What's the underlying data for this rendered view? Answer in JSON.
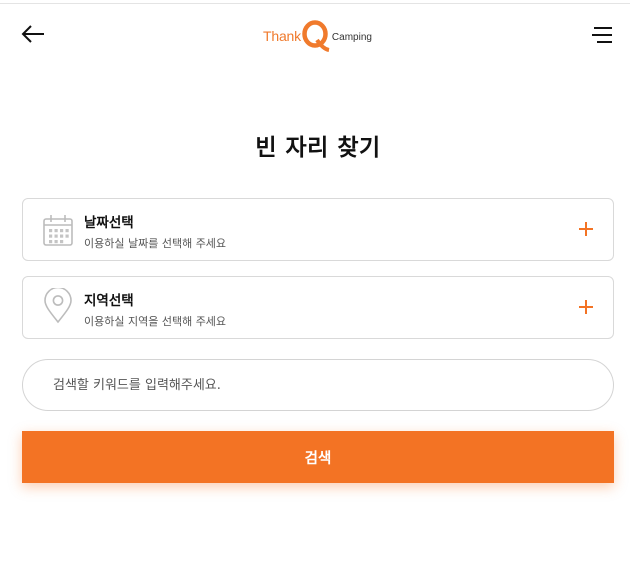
{
  "header": {
    "logo": {
      "left_text": "Thank",
      "letter": "Q",
      "right_text": "Camping"
    }
  },
  "page_title": "빈 자리 찾기",
  "date_select": {
    "label": "날짜선택",
    "description": "이용하실 날짜를 선택해 주세요"
  },
  "region_select": {
    "label": "지역선택",
    "description": "이용하실 지역을 선택해 주세요"
  },
  "search": {
    "placeholder": "검색할 키워드를 입력해주세요.",
    "value": ""
  },
  "search_button": {
    "label": "검색"
  },
  "icons": {
    "back": "arrow-left-icon",
    "menu": "hamburger-menu-icon",
    "date": "calendar-icon",
    "region": "location-pin-icon",
    "expand": "plus-icon"
  },
  "colors": {
    "accent": "#f37324",
    "logo_orange": "#f07a2c",
    "border": "#d9d9d9"
  }
}
